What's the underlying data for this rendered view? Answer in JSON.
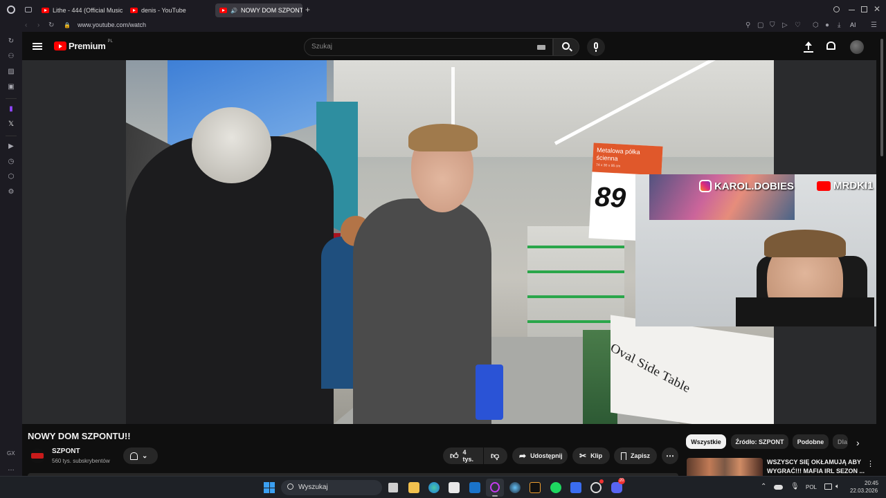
{
  "browser": {
    "tabs": [
      {
        "title": "Lithe - 444 (Official Music"
      },
      {
        "title": "denis - YouTube"
      },
      {
        "title": "NOWY DOM SZPONT"
      }
    ],
    "url": "www.youtube.com/watch",
    "ai_label": "AI",
    "gx_label": "GX"
  },
  "youtube": {
    "logo_text": "Premium",
    "logo_region": "PL",
    "search_placeholder": "Szukaj"
  },
  "video": {
    "overlay_instagram": "KAROL.DOBIES",
    "overlay_youtube": "MRDKI1",
    "sign_price": "89",
    "sign_label": "Metalowa półka ścienna",
    "sign_dims": "74 x 30 x 95 cm",
    "box_text": "Oval Side Table"
  },
  "meta": {
    "title": "NOWY DOM SZPONTU!!",
    "channel_name": "SZPONT",
    "subscribers": "560 tys. subskrybentów",
    "like_count": "4 tys.",
    "share_label": "Udostępnij",
    "clip_label": "Klip",
    "save_label": "Zapisz"
  },
  "chips": [
    {
      "label": "Wszystkie"
    },
    {
      "label": "Źródło: SZPONT"
    },
    {
      "label": "Podobne"
    },
    {
      "label": "Dla"
    }
  ],
  "recommended": {
    "title_line1": "WSZYSCY SIĘ OKŁAMUJĄ ABY",
    "title_line2": "WYGRAĆ!!! MAFIA IRL SEZON ..."
  },
  "taskbar": {
    "search_label": "Wyszukaj",
    "language": "POL",
    "time": "20:45",
    "date": "22.03.2026",
    "discord_badge": "20"
  }
}
